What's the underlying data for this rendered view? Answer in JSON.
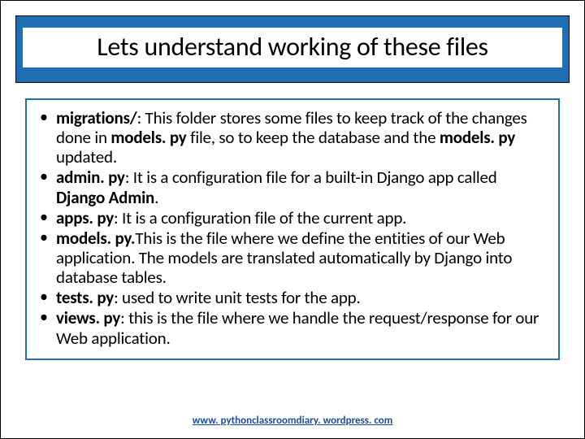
{
  "title": "Lets understand working of these files",
  "bullets": [
    {
      "label": "migrations/",
      "desc_pre": ": This folder stores some files to keep track of the changes done in ",
      "mid1": "models. py",
      "desc_mid": " file, so to keep the database and the ",
      "mid2": "models. py",
      "desc_post": " updated."
    },
    {
      "label": "admin. py",
      "desc_pre": ": It  is a configuration file for a built-in Django app called ",
      "mid1": "Django Admin",
      "desc_mid": ".",
      "mid2": "",
      "desc_post": ""
    },
    {
      "label": "apps. py",
      "desc_pre": ": It is a configuration file of the current app.",
      "mid1": "",
      "desc_mid": "",
      "mid2": "",
      "desc_post": ""
    },
    {
      "label": "models. py.",
      "desc_pre": "",
      "mid1": "",
      "desc_mid": "This is the file where we define the entities of our Web application. The models are translated automatically by Django into database tables.",
      "mid2": "",
      "desc_post": ""
    },
    {
      "label": "tests. py",
      "desc_pre": ": used to write unit tests for the app.",
      "mid1": "",
      "desc_mid": "",
      "mid2": "",
      "desc_post": ""
    },
    {
      "label": "views. py",
      "desc_pre": ": this is the file where we handle the request/response for our Web application.",
      "mid1": "",
      "desc_mid": "",
      "mid2": "",
      "desc_post": ""
    }
  ],
  "footer": "www. pythonclassroomdiary. wordpress. com"
}
